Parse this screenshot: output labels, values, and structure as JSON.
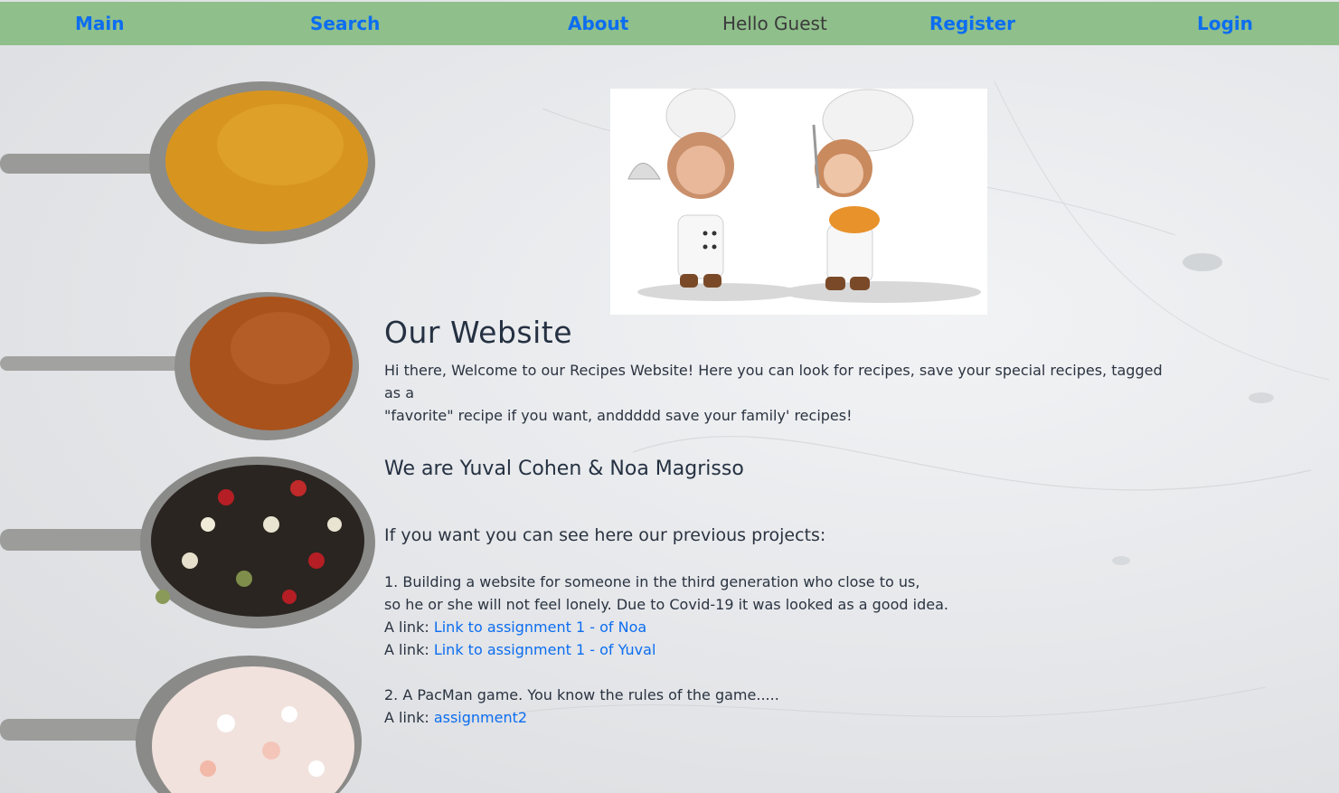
{
  "nav": {
    "main": "Main",
    "search": "Search",
    "about": "About",
    "greeting": "Hello Guest",
    "register": "Register",
    "login": "Login"
  },
  "about": {
    "title": "Our Website",
    "intro_line1": "Hi there, Welcome to our Recipes Website! Here you can look for recipes, save your special recipes, tagged as a",
    "intro_line2": "\"favorite\" recipe if you want, anddddd save your family' recipes!",
    "team": "We are Yuval Cohen & Noa Magrisso",
    "previous_heading": "If you want you can see here our previous projects:",
    "project1_line1": "1. Building a website for someone in the third generation who close to us,",
    "project1_line2": "so he or she will not feel lonely. Due to Covid-19 it was looked as a good idea.",
    "link_prefix": "A link: ",
    "link_noa": "Link to assignment 1 - of Noa",
    "link_yuval": "Link to assignment 1 - of Yuval",
    "project2_line": "2. A PacMan game. You know the rules of the game.....",
    "link_assignment2": "assignment2"
  },
  "colors": {
    "navbar": "#8fbf8b",
    "link": "#0c6df0",
    "text": "#2a3340"
  },
  "images": {
    "spoons": "spoons-with-spices-photo",
    "chefs": "two-chefs-cartoon-image"
  }
}
